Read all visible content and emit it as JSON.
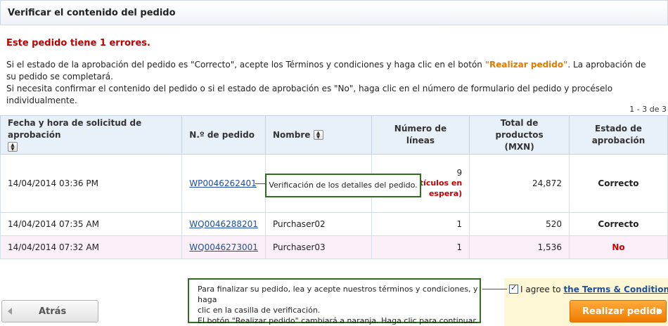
{
  "header": {
    "title": "Verificar el contenido del pedido"
  },
  "error": {
    "message": "Este pedido tiene 1 errores."
  },
  "instructions": {
    "line1_before": "Si el estado de la aprobación del pedido es \"Correcto\", acepte los Términos y condiciones y haga clic en el botón ",
    "line1_highlight": "\"Realizar pedido\"",
    "line1_after": ". La aprobación de su pedido se completará.",
    "line2": "Si necesita confirmar el contenido del pedido o si el estado de aprobación es \"No\", haga clic en el número de formulario del pedido y procéselo individualmente."
  },
  "pagination": {
    "count": "1 - 3 de 3"
  },
  "table": {
    "headers": {
      "date": "Fecha y hora de solicitud de aprobación",
      "order_no": "N.º de pedido",
      "name": "Nombre",
      "lines": "Número de líneas",
      "total_line1": "Total de productos",
      "total_line2": "(MXN)",
      "status_line1": "Estado de",
      "status_line2": "aprobación"
    },
    "rows": [
      {
        "date": "14/04/2014 03:36 PM",
        "order_no": "WP0046262401",
        "name": "",
        "lines": "9",
        "hold_line1": "tículos en",
        "hold_line2": "espera)",
        "total": "24,872",
        "status": "Correcto"
      },
      {
        "date": "14/04/2014 07:35 AM",
        "order_no": "WQ0046288201",
        "name": "Purchaser02",
        "lines": "1",
        "total": "520",
        "status": "Correcto"
      },
      {
        "date": "14/04/2014 07:32 AM",
        "order_no": "WQ0046273001",
        "name": "Purchaser03",
        "lines": "1",
        "total": "1,536",
        "status": "No"
      }
    ]
  },
  "callouts": {
    "order_details": "Verificación de los detalles del pedido.",
    "finalize_line1": "Para finalizar su pedido, lea y acepte nuestros términos y condiciones, y haga",
    "finalize_line2": "clic en la casilla de verificación.",
    "finalize_line3": "El botón \"Realizar pedido\" cambiará a naranja. Haga clic para continuar."
  },
  "agreement": {
    "prefix": "I agree to ",
    "link": "the Terms & Conditions",
    "suffix": ".",
    "checked": true
  },
  "buttons": {
    "back": "Atrás",
    "submit": "Realizar pedido"
  },
  "colors": {
    "error": "#c00000",
    "accent_orange": "#f07b00",
    "link": "#1f4fa0",
    "callout_border": "#2e6e1e"
  }
}
